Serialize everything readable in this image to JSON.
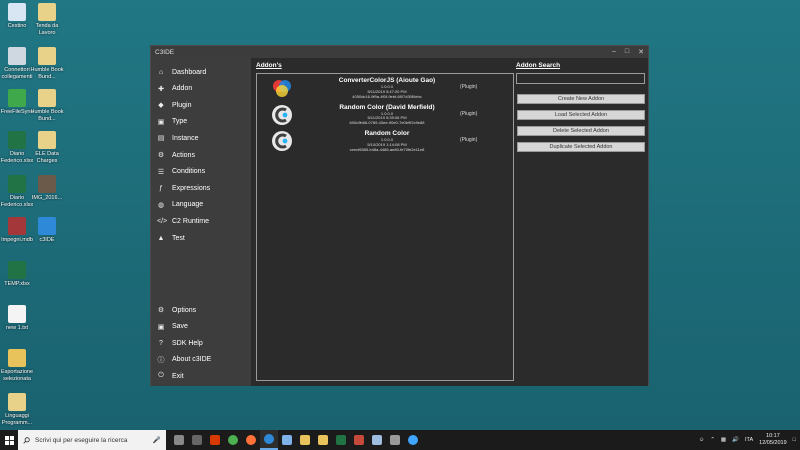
{
  "desktop": {
    "icons": [
      {
        "label": "Cestino",
        "color": "#d7e6f2"
      },
      {
        "label": "Tenda da Lavoro",
        "color": "#e8d28a"
      },
      {
        "label": "Connettori collegamenti",
        "color": "#cfd8e0"
      },
      {
        "label": "Humble Book Bund...",
        "color": "#e8d28a"
      },
      {
        "label": "FreeFileSync",
        "color": "#3fa84b"
      },
      {
        "label": "Humble Book Bund...",
        "color": "#e8d28a"
      },
      {
        "label": "Diario Federico.xlsx",
        "color": "#217346"
      },
      {
        "label": "ELE Data Charges",
        "color": "#e8d28a"
      },
      {
        "label": "Diario Federico.xlsx",
        "color": "#217346"
      },
      {
        "label": "IMG_2016...",
        "color": "#6b5a4a"
      },
      {
        "label": "Impegni.mdb",
        "color": "#a4373a"
      },
      {
        "label": "c3IDE",
        "color": "#2e8ad8"
      },
      {
        "label": "TEMP.xlsx",
        "color": "#217346"
      },
      {
        "label": "new 1.txt",
        "color": "#f4f4f4"
      },
      {
        "label": "Esportazione selezionata",
        "color": "#e8c25a"
      },
      {
        "label": "Linguaggi Programm...",
        "color": "#e8d28a"
      }
    ]
  },
  "window": {
    "title": "C3IDE",
    "controls": {
      "minimize": "–",
      "maximize": "□",
      "close": "✕"
    }
  },
  "sidebar": {
    "top": [
      {
        "label": "Dashboard",
        "icon": "home-icon",
        "glyph": "⌂"
      },
      {
        "label": "Addon",
        "icon": "plus-square-icon",
        "glyph": "✚"
      },
      {
        "label": "Plugin",
        "icon": "plug-icon",
        "glyph": "◆"
      },
      {
        "label": "Type",
        "icon": "type-icon",
        "glyph": "▣"
      },
      {
        "label": "Instance",
        "icon": "instance-icon",
        "glyph": "▤"
      },
      {
        "label": "Actions",
        "icon": "gears-icon",
        "glyph": "⚙"
      },
      {
        "label": "Conditions",
        "icon": "list-icon",
        "glyph": "☰"
      },
      {
        "label": "Expressions",
        "icon": "function-icon",
        "glyph": "ƒ"
      },
      {
        "label": "Language",
        "icon": "globe-icon",
        "glyph": "◍"
      },
      {
        "label": "C2 Runtime",
        "icon": "code-icon",
        "glyph": "</>"
      },
      {
        "label": "Test",
        "icon": "flask-icon",
        "glyph": "▲"
      }
    ],
    "bottom": [
      {
        "label": "Options",
        "icon": "gear-icon",
        "glyph": "⚙"
      },
      {
        "label": "Save",
        "icon": "save-icon",
        "glyph": "▣"
      },
      {
        "label": "SDK Help",
        "icon": "question-icon",
        "glyph": "?"
      },
      {
        "label": "About c3IDE",
        "icon": "info-icon",
        "glyph": "ⓘ"
      },
      {
        "label": "Exit",
        "icon": "power-icon",
        "glyph": "⏻"
      }
    ]
  },
  "main": {
    "addons_header": "Addon's",
    "search_header": "Addon Search",
    "search_value": "",
    "addons": [
      {
        "name": "ConverterColorJS (Aioute Gao)",
        "version": "1.0.0.0",
        "date": "5/11/2019 5:47:20 PM",
        "id": "4050dc16-9f9a-4f0f-9ebf-6f07d30f0ebc",
        "kind": "(Plugin)",
        "logo": "colorful"
      },
      {
        "name": "Random Color (David Merfield)",
        "version": "1.0.0.0",
        "date": "5/11/2019 5:39:06 PM",
        "id": "600c9b66-0789-43ee-90e0-7e0b9f2c9e88",
        "kind": "(Plugin)",
        "logo": "c3"
      },
      {
        "name": "Random Color",
        "version": "1.0.0.0",
        "date": "5/10/2019 1:14:08 PM",
        "id": "ceecf6585-b48a-4486-ae80-fe70fe2e11e8",
        "kind": "(Plugin)",
        "logo": "c3"
      }
    ],
    "buttons": [
      "Create New Addon",
      "Load Selected Addon",
      "Delete Selected Addon",
      "Duplicate Selected Addon"
    ]
  },
  "taskbar": {
    "search_placeholder": "Scrivi qui per eseguire la ricerca",
    "apps": [
      {
        "icon": "task-view-icon",
        "color": "#888888"
      },
      {
        "icon": "calculator-icon",
        "color": "#666666"
      },
      {
        "icon": "office-icon",
        "color": "#d83b01"
      },
      {
        "icon": "chrome-icon",
        "color": "#4caf50"
      },
      {
        "icon": "firefox-icon",
        "color": "#ff7139"
      },
      {
        "icon": "c3ide-taskbar-icon",
        "color": "#2e8ad8"
      },
      {
        "icon": "remote-icon",
        "color": "#7fb2e8"
      },
      {
        "icon": "file-explorer-icon",
        "color": "#e8c25a"
      },
      {
        "icon": "folder-icon",
        "color": "#e8c25a"
      },
      {
        "icon": "excel-icon",
        "color": "#217346"
      },
      {
        "icon": "app-icon",
        "color": "#c64a3a"
      },
      {
        "icon": "notepad-icon",
        "color": "#9fbde0"
      },
      {
        "icon": "app2-icon",
        "color": "#9a9a9a"
      },
      {
        "icon": "c3-icon",
        "color": "#3ea6ff"
      }
    ],
    "lang": "ITA",
    "time": "10:17",
    "date": "12/05/2019"
  }
}
